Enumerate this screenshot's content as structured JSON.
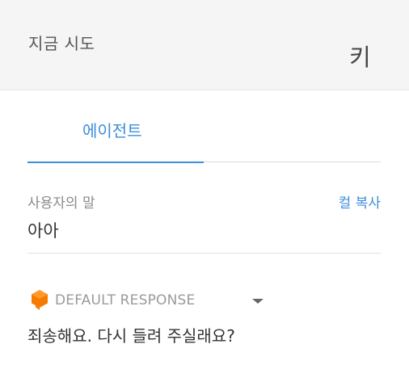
{
  "header": {
    "title": "지금 시도",
    "key_label": "키 "
  },
  "tabs": [
    {
      "label": "에이전트",
      "active": true
    }
  ],
  "user_says": {
    "label": "사용자의 말",
    "copy_label": "컬 복사",
    "text": "아아"
  },
  "response": {
    "icon": "dialogflow-icon",
    "intent_label": "DEFAULT RESPONSE",
    "dropdown_icon": "chevron-down-icon",
    "text": "죄송해요. 다시 들려 주실래요?"
  },
  "colors": {
    "accent": "#3a8fd9",
    "icon_orange": "#f57c00",
    "header_bg": "#f5f5f5"
  }
}
